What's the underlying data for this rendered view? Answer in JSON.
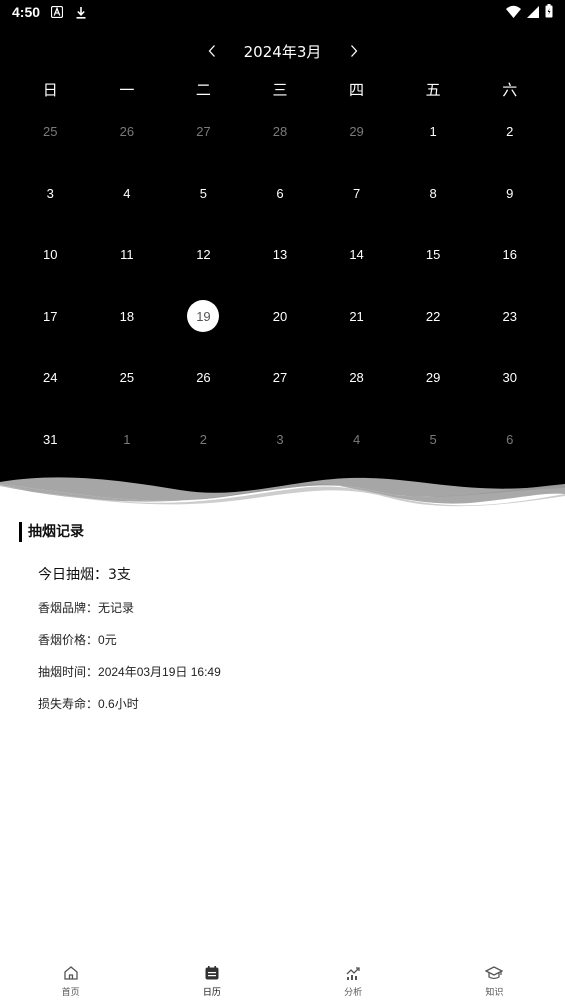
{
  "status_bar": {
    "time": "4:50",
    "left_icons": [
      "font-a-icon",
      "download-icon"
    ],
    "right_icons": [
      "wifi-icon",
      "cell-signal-icon",
      "battery-icon"
    ]
  },
  "calendar": {
    "month_title": "2024年3月",
    "weekdays": [
      "日",
      "一",
      "二",
      "三",
      "四",
      "五",
      "六"
    ],
    "days": [
      {
        "label": "25",
        "muted": true
      },
      {
        "label": "26",
        "muted": true
      },
      {
        "label": "27",
        "muted": true
      },
      {
        "label": "28",
        "muted": true
      },
      {
        "label": "29",
        "muted": true
      },
      {
        "label": "1"
      },
      {
        "label": "2"
      },
      {
        "label": "3"
      },
      {
        "label": "4"
      },
      {
        "label": "5"
      },
      {
        "label": "6"
      },
      {
        "label": "7"
      },
      {
        "label": "8"
      },
      {
        "label": "9"
      },
      {
        "label": "10"
      },
      {
        "label": "11"
      },
      {
        "label": "12"
      },
      {
        "label": "13"
      },
      {
        "label": "14"
      },
      {
        "label": "15"
      },
      {
        "label": "16"
      },
      {
        "label": "17"
      },
      {
        "label": "18"
      },
      {
        "label": "19",
        "selected": true
      },
      {
        "label": "20"
      },
      {
        "label": "21"
      },
      {
        "label": "22"
      },
      {
        "label": "23"
      },
      {
        "label": "24"
      },
      {
        "label": "25"
      },
      {
        "label": "26"
      },
      {
        "label": "27"
      },
      {
        "label": "28"
      },
      {
        "label": "29"
      },
      {
        "label": "30"
      },
      {
        "label": "31"
      },
      {
        "label": "1",
        "muted": true
      },
      {
        "label": "2",
        "muted": true
      },
      {
        "label": "3",
        "muted": true
      },
      {
        "label": "4",
        "muted": true
      },
      {
        "label": "5",
        "muted": true
      },
      {
        "label": "6",
        "muted": true
      }
    ]
  },
  "record": {
    "title": "抽烟记录",
    "today": "今日抽烟：3支",
    "lines": [
      {
        "label": "香烟品牌：",
        "value": "无记录"
      },
      {
        "label": "香烟价格：",
        "value": "0元"
      },
      {
        "label": "抽烟时间：",
        "value": "2024年03月19日 16:49"
      },
      {
        "label": "损失寿命：",
        "value": "0.6小时"
      }
    ]
  },
  "bottom_nav": {
    "items": [
      {
        "label": "首页",
        "icon": "home-icon"
      },
      {
        "label": "日历",
        "icon": "calendar-icon",
        "active": true
      },
      {
        "label": "分析",
        "icon": "chart-icon"
      },
      {
        "label": "知识",
        "icon": "graduation-cap-icon"
      }
    ]
  }
}
